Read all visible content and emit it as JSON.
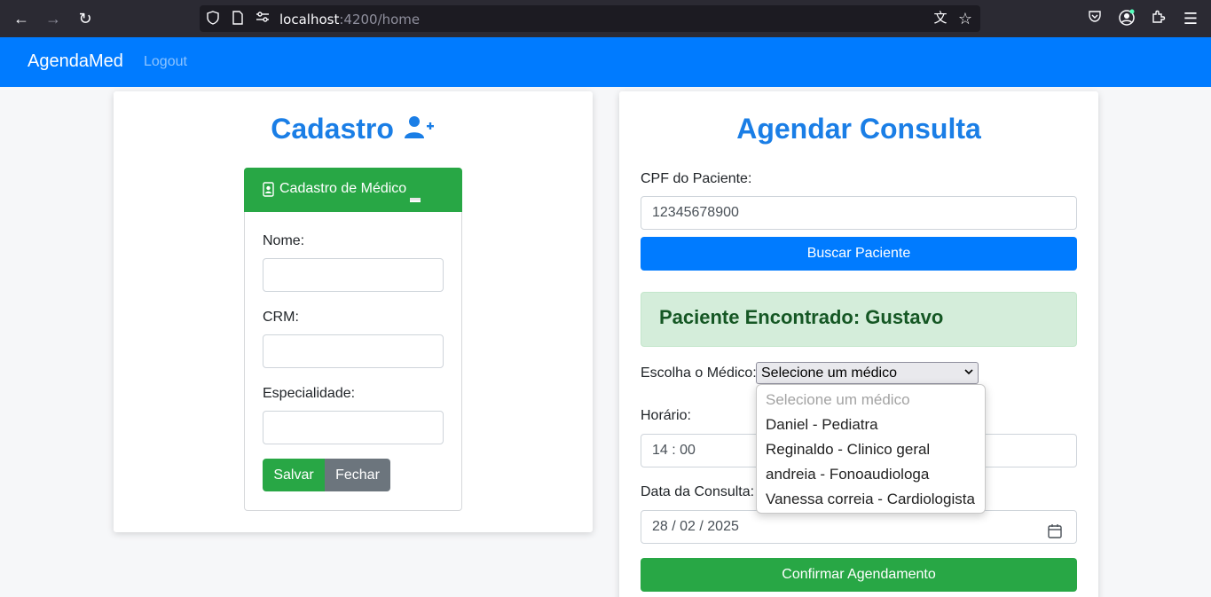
{
  "browser": {
    "url_host": "localhost",
    "url_path": ":4200/home"
  },
  "navbar": {
    "brand": "AgendaMed",
    "logout": "Logout"
  },
  "cadastro": {
    "title": "Cadastro",
    "form_header": "Cadastro de Médico",
    "fields": [
      {
        "label": "Nome:",
        "value": ""
      },
      {
        "label": "CRM:",
        "value": ""
      },
      {
        "label": "Especialidade:",
        "value": ""
      }
    ],
    "save_label": "Salvar",
    "close_label": "Fechar"
  },
  "agendar": {
    "title": "Agendar Consulta",
    "cpf_label": "CPF do Paciente:",
    "cpf_value": "12345678900",
    "search_button": "Buscar Paciente",
    "found_text": "Paciente Encontrado: Gustavo",
    "doctor_label": "Escolha o Médico:",
    "doctor_selected": "Selecione um médico",
    "doctor_options": [
      "Selecione um médico",
      "Daniel - Pediatra",
      "Reginaldo - Clinico geral",
      "andreia - Fonoaudiologa",
      "Vanessa correia - Cardiologista"
    ],
    "time_label": "Horário:",
    "time_hour": "14",
    "time_min": "00",
    "date_label": "Data da Consulta:",
    "date_day": "28",
    "date_month": "02",
    "date_year": "2025",
    "confirm_button": "Confirmar Agendamento"
  },
  "colors": {
    "primary": "#007bff",
    "success": "#28a745",
    "secondary": "#6c757d",
    "title": "#1a7ee6"
  }
}
